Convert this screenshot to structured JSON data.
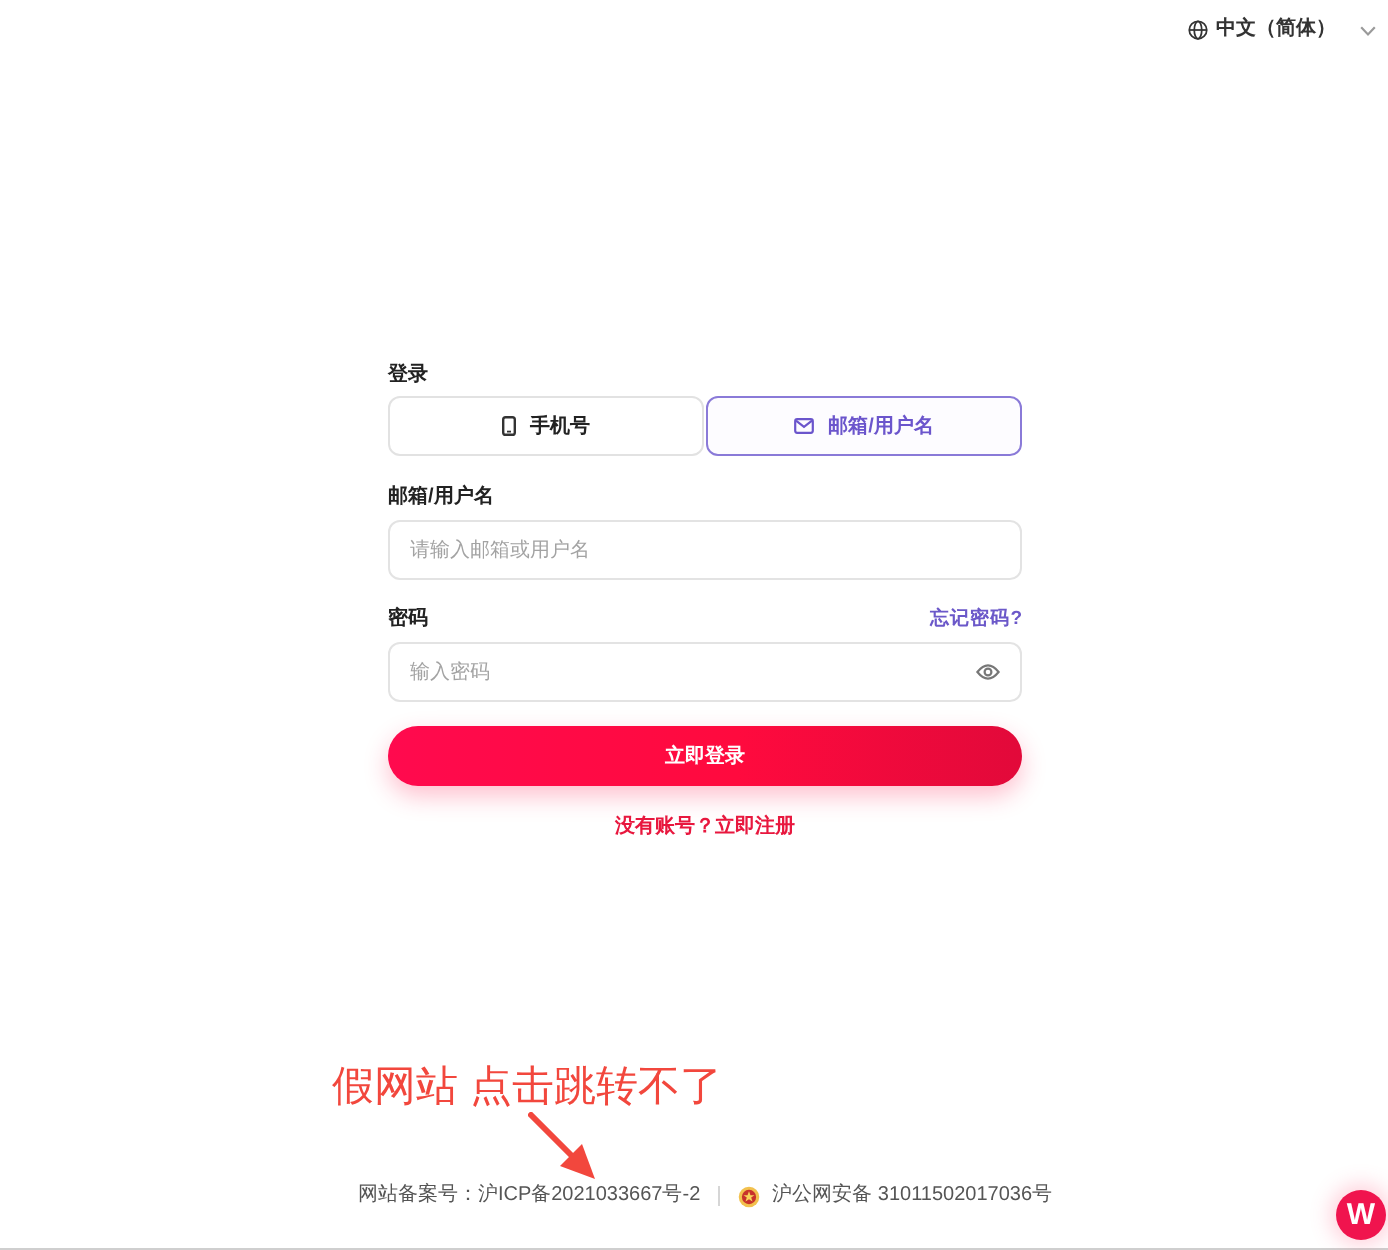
{
  "language_selector": {
    "label": "中文（简体）"
  },
  "login": {
    "title": "登录",
    "tabs": [
      {
        "label": "手机号",
        "kind": "phone",
        "selected": false
      },
      {
        "label": "邮箱/用户名",
        "kind": "email",
        "selected": true
      }
    ],
    "fields": [
      {
        "kind": "text",
        "label": "邮箱/用户名",
        "placeholder": "请输入邮箱或用户名"
      },
      {
        "kind": "password",
        "label": "密码",
        "placeholder": "输入密码",
        "link": "忘记密码?"
      }
    ],
    "submit_button": "立即登录",
    "register_link": "没有账号？立即注册"
  },
  "annotation": {
    "text": "假网站 点击跳转不了"
  },
  "footer": {
    "items": [
      {
        "kind": "icp",
        "text": "网站备案号：沪ICP备2021033667号-2"
      },
      {
        "kind": "police",
        "text": "沪公网安备 31011502017036号"
      }
    ]
  },
  "floating_button": {
    "label": "W"
  }
}
